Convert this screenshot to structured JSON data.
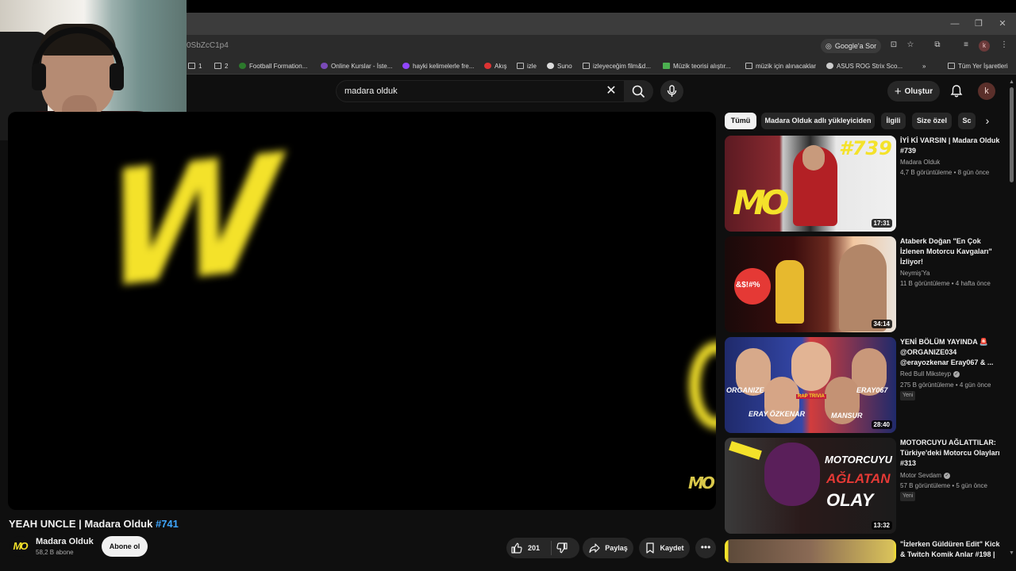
{
  "browser": {
    "url_fragment": "0SbZcC1p4",
    "google_sor": "Google'a Sor",
    "profile_letter": "k",
    "bookmarks": [
      "1",
      "2",
      "Football Formation...",
      "Online Kurslar - İste...",
      "hayki kelimelerle fre...",
      "Akış",
      "izle",
      "Suno",
      "izleyeceğim film&d...",
      "Müzik teorisi alıştır...",
      "müzik için alınacaklar",
      "ASUS ROG Strix Sco...",
      "»",
      "Tüm Yer İşaretleri"
    ]
  },
  "masthead": {
    "search_query": "madara olduk",
    "create_label": "Oluştur",
    "avatar_letter": "k"
  },
  "video": {
    "title": "YEAH UNCLE | Madara Olduk",
    "episode_tag": "#741",
    "channel": "Madara Olduk",
    "subscribers": "58,2 B abone",
    "subscribe_label": "Abone ol",
    "likes": "201",
    "share_label": "Paylaş",
    "save_label": "Kaydet",
    "channel_logo": "MO"
  },
  "chips": [
    "Tümü",
    "Madara Olduk adlı yükleyiciden",
    "İlgili",
    "Size özel",
    "Sc"
  ],
  "recommendations": [
    {
      "title": "İYİ Kİ VARSIN | Madara Olduk #739",
      "channel": "Madara Olduk",
      "verified": false,
      "meta": "4,7 B görüntüleme • 8 gün önce",
      "duration": "17:31",
      "is_new": false,
      "thumb_text": "#739",
      "thumb_logo": "MO"
    },
    {
      "title": "Ataberk Doğan \"En Çok İzlenen Motorcu Kavgaları\" İzliyor!",
      "channel": "Neymiş'Ya",
      "verified": false,
      "meta": "11 B görüntüleme • 4 hafta önce",
      "duration": "34:14",
      "is_new": false,
      "thumb_text": "&$!#%"
    },
    {
      "title": "YENİ BÖLÜM YAYINDA 🚨 @ORGANIZE034 @erayozkenar  Eray067 & ...",
      "channel": "Red Bull Miksteyp",
      "verified": true,
      "meta": "275 B görüntüleme • 4 gün önce",
      "duration": "28:40",
      "is_new": true,
      "thumb_labels": [
        "ORGANIZE",
        "ERAY067",
        "ERAY ÖZKENAR",
        "MANSUR",
        "RAP TRIVIA"
      ]
    },
    {
      "title": "MOTORCUYU AĞLATTILAR: Türkiye'deki Motorcu Olayları #313",
      "channel": "Motor Sevdam",
      "verified": true,
      "meta": "57 B görüntüleme • 5 gün önce",
      "duration": "13:32",
      "is_new": true,
      "thumb_lines": [
        "MOTORCUYU",
        "AĞLATAN",
        "OLAY"
      ]
    },
    {
      "title": "\"İzlerken Güldüren Edit\" Kick & Twitch Komik Anlar #198 |",
      "channel": "",
      "verified": false,
      "meta": "",
      "duration": "",
      "is_new": false
    }
  ],
  "new_badge": "Yeni",
  "colors": {
    "accent_yellow": "#f4e22a",
    "link_blue": "#3ea6ff",
    "bg": "#0f0f0f"
  }
}
